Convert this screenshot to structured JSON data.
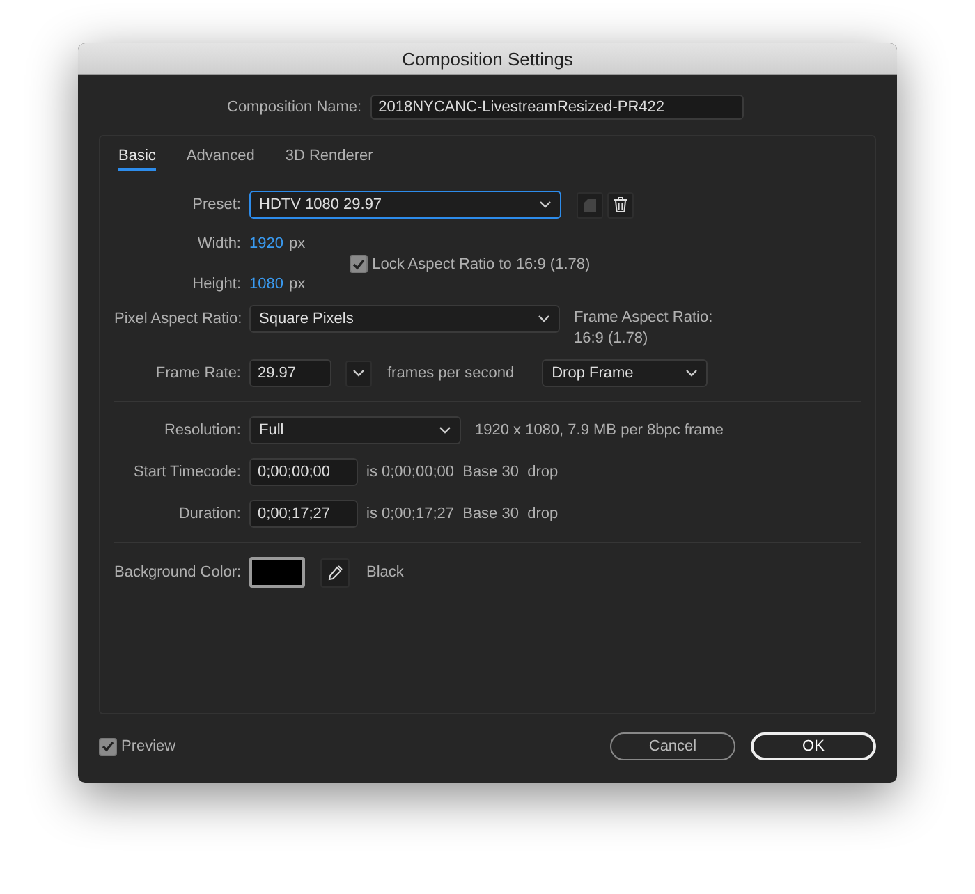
{
  "window": {
    "title": "Composition Settings"
  },
  "composition_name": {
    "label": "Composition Name:",
    "value": "2018NYCANC-LivestreamResized-PR422"
  },
  "tabs": [
    {
      "label": "Basic",
      "selected": true
    },
    {
      "label": "Advanced",
      "selected": false
    },
    {
      "label": "3D Renderer",
      "selected": false
    }
  ],
  "preset": {
    "label": "Preset:",
    "value": "HDTV 1080 29.97",
    "focused": true
  },
  "width": {
    "label": "Width:",
    "value": "1920",
    "unit": "px"
  },
  "height": {
    "label": "Height:",
    "value": "1080",
    "unit": "px"
  },
  "lock_aspect": {
    "label": "Lock Aspect Ratio to 16:9 (1.78)",
    "checked": true
  },
  "pixel_aspect_ratio": {
    "label": "Pixel Aspect Ratio:",
    "value": "Square Pixels"
  },
  "frame_aspect_ratio": {
    "label": "Frame Aspect Ratio:",
    "value": "16:9 (1.78)"
  },
  "frame_rate": {
    "label": "Frame Rate:",
    "value": "29.97",
    "unit": "frames per second",
    "mode": "Drop Frame"
  },
  "resolution": {
    "label": "Resolution:",
    "value": "Full",
    "info": "1920 x 1080, 7.9 MB per 8bpc frame"
  },
  "start_timecode": {
    "label": "Start Timecode:",
    "value": "0;00;00;00",
    "info": "is 0;00;00;00  Base 30  drop"
  },
  "duration": {
    "label": "Duration:",
    "value": "0;00;17;27",
    "info": "is 0;00;17;27  Base 30  drop"
  },
  "background_color": {
    "label": "Background Color:",
    "color": "#000000",
    "name": "Black"
  },
  "preview": {
    "label": "Preview",
    "checked": true
  },
  "buttons": [
    {
      "label": "Cancel",
      "default": false
    },
    {
      "label": "OK",
      "default": true
    }
  ]
}
